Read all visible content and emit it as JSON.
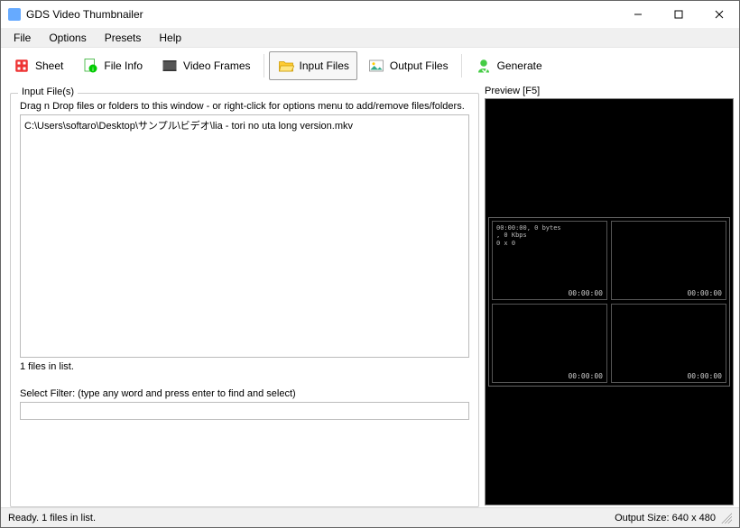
{
  "window": {
    "title": "GDS Video Thumbnailer"
  },
  "menu": {
    "file": "File",
    "options": "Options",
    "presets": "Presets",
    "help": "Help"
  },
  "toolbar": {
    "sheet": "Sheet",
    "file_info": "File Info",
    "video_frames": "Video Frames",
    "input_files": "Input Files",
    "output_files": "Output Files",
    "generate": "Generate"
  },
  "input_panel": {
    "legend": "Input File(s)",
    "hint": "Drag n Drop files or folders to this window - or right-click for options menu to add/remove files/folders.",
    "files": [
      "C:\\Users\\softaro\\Desktop\\サンプル\\ビデオ\\lia - tori no uta long version.mkv"
    ],
    "count_text": "1 files in list.",
    "filter_label": "Select Filter:   (type any word and press enter to find and select)",
    "filter_value": ""
  },
  "preview": {
    "label": "Preview  [F5]",
    "thumbs": [
      {
        "meta": "00:00:00, 0 bytes\n, 0 Kbps\n0 x 0",
        "ts": "00:00:00"
      },
      {
        "meta": "",
        "ts": "00:00:00"
      },
      {
        "meta": "",
        "ts": "00:00:00"
      },
      {
        "meta": "",
        "ts": "00:00:00"
      }
    ]
  },
  "status": {
    "left": "Ready. 1 files in list.",
    "right": "Output Size: 640 x 480"
  }
}
